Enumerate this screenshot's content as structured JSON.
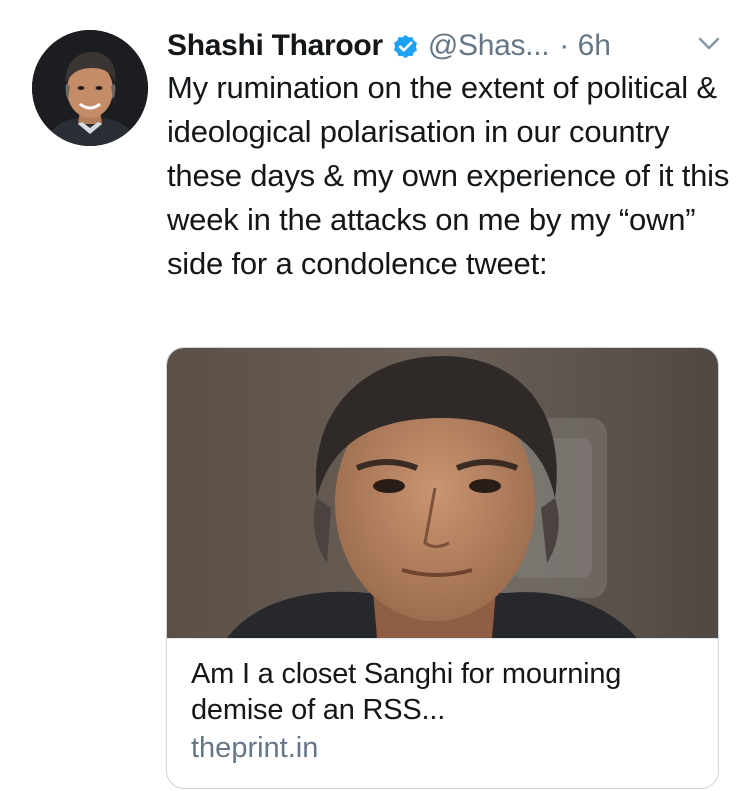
{
  "tweet": {
    "author_name": "Shashi Tharoor",
    "author_handle": "@Shas...",
    "separator_time": "· 6h",
    "verified": true,
    "text": "My rumination on the extent of political & ideological polarisation in our country these days & my own experience of it this week in the attacks on me by my “own” side for a condolence tweet:",
    "icons": {
      "verified": "verified-badge-icon",
      "more": "chevron-down-icon"
    },
    "colors": {
      "verified_blue": "#1da1f2",
      "secondary_text": "#657786"
    }
  },
  "card": {
    "title": "Am I a closet Sanghi for mourning demise of an RSS...",
    "domain": "theprint.in"
  }
}
